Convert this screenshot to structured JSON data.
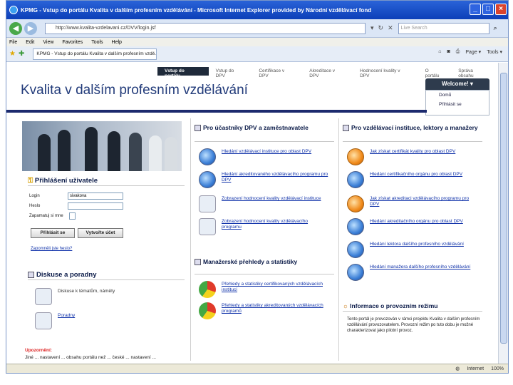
{
  "window": {
    "title": "KPMG - Vstup do portálu Kvalita v dalším profesním vzdělávání - Microsoft Internet Explorer provided by Národní vzdělávací fond"
  },
  "browser": {
    "address": "http://www.kvalita-vzdelavani.cz/DVV/login.jsf",
    "search_placeholder": "Live Search",
    "menu": [
      "File",
      "Edit",
      "View",
      "Favorites",
      "Tools",
      "Help"
    ],
    "tab_title": "KPMG - Vstup do portálu Kvalita v dalším profesním vzdě...",
    "tools": [
      "Page ▾",
      "Tools ▾"
    ]
  },
  "site": {
    "nav": [
      "Vstup do portálu",
      "Vstup do DPV",
      "Certifikace v DPV",
      "Akreditace v DPV",
      "Hodnocení kvality v DPV",
      "O portálu",
      "Správa obsahu"
    ],
    "title": "Kvalita v dalším profesním vzdělávání",
    "welcome": "Welcome!",
    "welcome_menu": [
      "Domů",
      "Přihlásit se"
    ]
  },
  "login": {
    "heading": "Přihlášení uživatele",
    "login_label": "Login",
    "login_value": "sivakova",
    "password_label": "Heslo",
    "remember_label": "Zapamatuj si mne",
    "login_button": "Přihlásit se",
    "register_button": "Vytvořte účet",
    "forgot_link": "Zapomněli jste heslo?"
  },
  "forum": {
    "heading": "Diskuse a poradny",
    "items": [
      "Diskuse k tématům, náměty",
      "Poradny"
    ]
  },
  "notice": {
    "heading": "Upozornění:",
    "text": "Jiné ... nastavení ... obsahu portálu než ... české ... nastavení ..."
  },
  "participants": {
    "heading": "Pro účastníky DPV a zaměstnavatele",
    "items": [
      "Hledání vzdělávací instituce pro oblast DPV",
      "Hledání akreditovaného vzdělávacího programu pro DPV",
      "Zobrazení hodnocení kvality vzdělávací instituce",
      "Zobrazení hodnocení kvality vzdělávacího programu"
    ]
  },
  "managers": {
    "heading": "Manažerské přehledy a statistiky",
    "items": [
      "Přehledy a statistiky certifikovaných vzdělávacích institucí",
      "Přehledy a statistiky akreditovaných vzdělávacích programů"
    ]
  },
  "institutions": {
    "heading": "Pro vzdělávací instituce, lektory a manažery",
    "items": [
      "Jak získat certifikát kvality pro oblast DPV",
      "Hledání certifikačního orgánu pro oblast DPV",
      "Jak získat akreditaci vzdělávacího programu pro DPV",
      "Hledání akreditačního orgánu pro oblast DPV",
      "Hledání lektora dalšího profesního vzdělávání",
      "Hledání manažera dalšího profesního vzdělávání"
    ]
  },
  "info": {
    "heading": "Informace o provozním režimu",
    "text": "Tento portál je provozován v rámci projektu Kvalita v dalším profesním vzdělávání provozovatelem. Provozní režim po tuto dobu je možné charakterizovat jako pilotní provoz."
  },
  "status": {
    "zone": "Internet",
    "zoom": "100%"
  }
}
